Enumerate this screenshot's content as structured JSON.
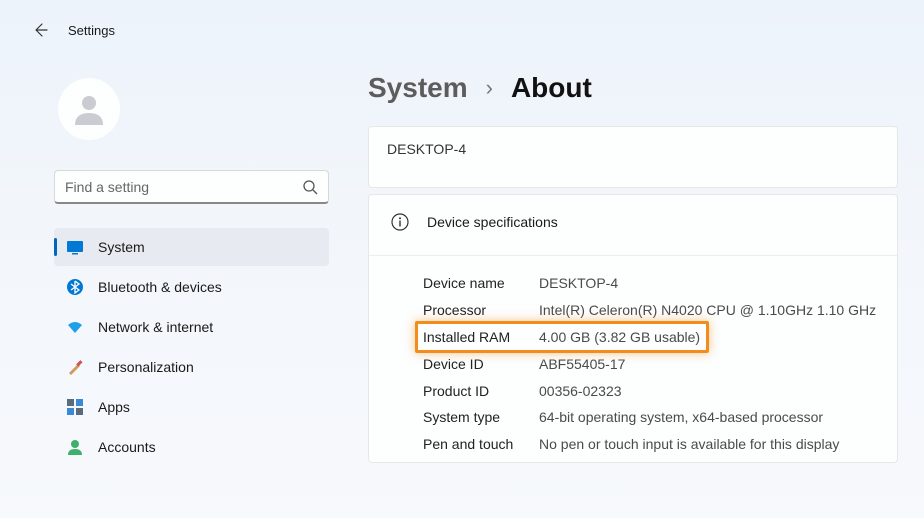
{
  "header": {
    "title": "Settings"
  },
  "search": {
    "placeholder": "Find a setting"
  },
  "sidebar": {
    "items": [
      {
        "label": "System"
      },
      {
        "label": "Bluetooth & devices"
      },
      {
        "label": "Network & internet"
      },
      {
        "label": "Personalization"
      },
      {
        "label": "Apps"
      },
      {
        "label": "Accounts"
      }
    ]
  },
  "breadcrumb": {
    "parent": "System",
    "current": "About"
  },
  "device_name_card": "DESKTOP-4",
  "specs": {
    "title": "Device specifications",
    "rows": [
      {
        "label": "Device name",
        "value": "DESKTOP-4"
      },
      {
        "label": "Processor",
        "value": "Intel(R) Celeron(R) N4020 CPU @ 1.10GHz   1.10 GHz"
      },
      {
        "label": "Installed RAM",
        "value": "4.00 GB (3.82 GB usable)"
      },
      {
        "label": "Device ID",
        "value": "ABF55405-17"
      },
      {
        "label": "Product ID",
        "value": "00356-02323"
      },
      {
        "label": "System type",
        "value": "64-bit operating system, x64-based processor"
      },
      {
        "label": "Pen and touch",
        "value": "No pen or touch input is available for this display"
      }
    ]
  }
}
